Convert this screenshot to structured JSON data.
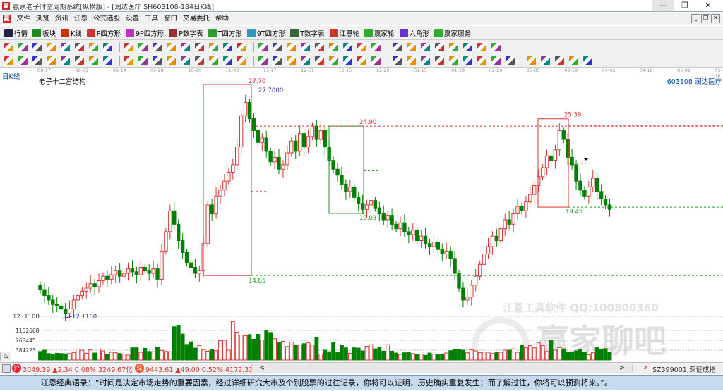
{
  "window": {
    "title": "赢家老子时空周期系统[纵横版] - [润达医疗  SH603108-184日K线]",
    "min": "—",
    "max": "❐",
    "close": "✕"
  },
  "menu": [
    "文件",
    "浏览",
    "资讯",
    "江恩",
    "公式选股",
    "设置",
    "工具",
    "窗口",
    "交易委托",
    "帮助"
  ],
  "mdi": {
    "min": "_",
    "restore": "❐",
    "close": "✕"
  },
  "toolbar1": [
    {
      "label": "行情",
      "icon": "grid-icon",
      "color": "#224"
    },
    {
      "label": "板块",
      "icon": "blocks-icon",
      "color": "#282"
    },
    {
      "label": "K线",
      "icon": "kline-icon",
      "color": "#c30"
    },
    {
      "label": "P四方形",
      "icon": "ps-icon",
      "color": "#c33"
    },
    {
      "label": "9P四方形",
      "icon": "p9-icon",
      "color": "#b3b"
    },
    {
      "label": "P数字表",
      "icon": "pn-icon",
      "color": "#933"
    },
    {
      "label": "T四方形",
      "icon": "ts-icon",
      "color": "#393"
    },
    {
      "label": "9T四方形",
      "icon": "t9-icon",
      "color": "#39b"
    },
    {
      "label": "T数字表",
      "icon": "tn-icon",
      "color": "#363"
    },
    {
      "label": "江恩轮",
      "icon": "gann-wheel-icon",
      "color": "#c33"
    },
    {
      "label": "赢家轮",
      "icon": "winner-wheel-icon",
      "color": "#3a3"
    },
    {
      "label": "六角形",
      "icon": "hexagon-icon",
      "color": "#63c"
    },
    {
      "label": "赢家服务",
      "icon": "dollar-icon",
      "color": "#3a3"
    }
  ],
  "toolbar2_count": 34,
  "toolbar3_count": 40,
  "period_label": "日K线",
  "chart_title": "老子十二宫结构",
  "stock_label": "603108  润达医疗",
  "watermark": {
    "line1": "江恩工具软件  QQ:100800360",
    "line2": "赢家聊吧",
    "line3": "liaoba.yicf360.com"
  },
  "chart_data": {
    "type": "candlestick",
    "date_ticks": [
      "08-17",
      "08-31",
      "09-14",
      "09-28",
      "10-20",
      "11-03",
      "11-17",
      "12-01",
      "12-15",
      "12-29",
      "01-15",
      "01-29",
      "02-20",
      "03-05",
      "03-19",
      "04-02",
      "04-18",
      "05-02",
      "05-16"
    ],
    "closes": [
      13.9,
      13.5,
      13.2,
      12.9,
      12.8,
      12.6,
      12.3,
      12.6,
      13.2,
      13.5,
      13.8,
      14.0,
      14.3,
      14.1,
      14.5,
      14.8,
      14.6,
      14.9,
      15.2,
      14.8,
      15.0,
      15.3,
      15.1,
      14.9,
      15.4,
      15.2,
      15.0,
      15.3,
      14.6,
      16.5,
      17.8,
      19.2,
      18.3,
      17.2,
      16.4,
      15.7,
      15.4,
      15.0,
      15.2,
      17.0,
      19.6,
      19.0,
      20.2,
      20.6,
      21.2,
      21.8,
      22.3,
      23.5,
      25.6,
      26.5,
      25.4,
      24.6,
      23.8,
      24.1,
      23.2,
      22.5,
      22.8,
      22.0,
      22.3,
      23.1,
      23.9,
      23.2,
      24.4,
      23.5,
      24.2,
      24.9,
      24.0,
      24.6,
      23.5,
      22.6,
      22.0,
      21.6,
      21.0,
      20.5,
      20.8,
      20.1,
      19.7,
      19.3,
      19.6,
      19.9,
      19.4,
      19.0,
      18.6,
      18.9,
      18.3,
      18.0,
      18.4,
      17.8,
      17.6,
      17.9,
      17.2,
      17.5,
      17.0,
      16.8,
      17.1,
      16.6,
      16.3,
      16.5,
      16.0,
      15.0,
      14.0,
      13.2,
      13.4,
      14.2,
      14.8,
      15.6,
      16.3,
      16.8,
      17.5,
      17.2,
      18.0,
      18.6,
      18.3,
      19.0,
      19.5,
      19.2,
      19.8,
      20.3,
      20.9,
      21.5,
      22.1,
      22.9,
      22.6,
      23.3,
      24.6,
      24.0,
      22.8,
      22.3,
      21.2,
      20.6,
      20.2,
      20.8,
      21.4,
      20.5,
      20.0,
      19.6,
      19.3
    ],
    "volumes": [
      330,
      380,
      250,
      220,
      260,
      250,
      240,
      250,
      290,
      420,
      380,
      260,
      390,
      270,
      420,
      350,
      220,
      300,
      280,
      250,
      230,
      190,
      470,
      470,
      300,
      450,
      330,
      320,
      490,
      370,
      330,
      320,
      1280,
      1330,
      1000,
      600,
      700,
      460,
      560,
      400,
      340,
      390,
      360,
      750,
      760,
      380,
      1480,
      1070,
      960,
      940,
      980,
      800,
      990,
      770,
      1140,
      1060,
      820,
      690,
      720,
      520,
      690,
      580,
      580,
      630,
      670,
      580,
      870,
      230,
      380,
      320,
      680,
      310,
      560,
      470,
      260,
      470,
      460,
      350,
      530,
      590,
      430,
      500,
      340,
      590,
      340,
      270,
      220,
      280,
      290,
      250,
      210,
      230,
      180,
      270,
      230,
      200,
      230,
      270,
      360,
      420,
      410,
      380,
      280,
      390,
      350,
      290,
      310,
      300,
      250,
      310,
      300,
      380,
      380,
      430,
      300,
      560,
      470,
      560,
      470,
      660,
      560,
      330,
      750,
      380,
      480,
      430,
      290,
      290,
      350,
      400,
      300,
      200,
      280,
      470,
      400,
      440,
      300,
      260,
      380,
      300,
      200
    ],
    "price_range": [
      12.11,
      27.7
    ],
    "y_label": "12. 1100",
    "volume_ticks": [
      "1152668",
      "768445",
      "384223"
    ],
    "annotations": [
      {
        "label": "27.70",
        "color": "#d33"
      },
      {
        "label": "27.7000",
        "color": "#33a"
      },
      {
        "label": "24.90",
        "color": "#d33"
      },
      {
        "label": "19.03",
        "color": "#292"
      },
      {
        "label": "14.85",
        "color": "#292"
      },
      {
        "label": "25.39",
        "color": "#d33"
      },
      {
        "label": "19.45",
        "color": "#292"
      },
      {
        "label": "12.1100",
        "color": "#33a"
      }
    ],
    "up_color": "#d33",
    "down_color": "#008000"
  },
  "status": {
    "sh_index": "3049.39 ▲2.34 0.08% 3249.67亿",
    "sz_index": "9443.61 ▲49.00 0.52% 4172.33亿",
    "sh_badge": "沪",
    "sz_badge": "深",
    "index_name": "SZ399001,深证成指",
    "scroll_left": "<",
    "scroll_right": ">",
    "collapse": "△"
  },
  "quote": "江恩经典语录：“时间是决定市场走势的重要因素，经过详细研究大市及个别股票的过往记录，你将可以证明，历史确实重复发生；而了解过往，你将可以预测将来。”。"
}
